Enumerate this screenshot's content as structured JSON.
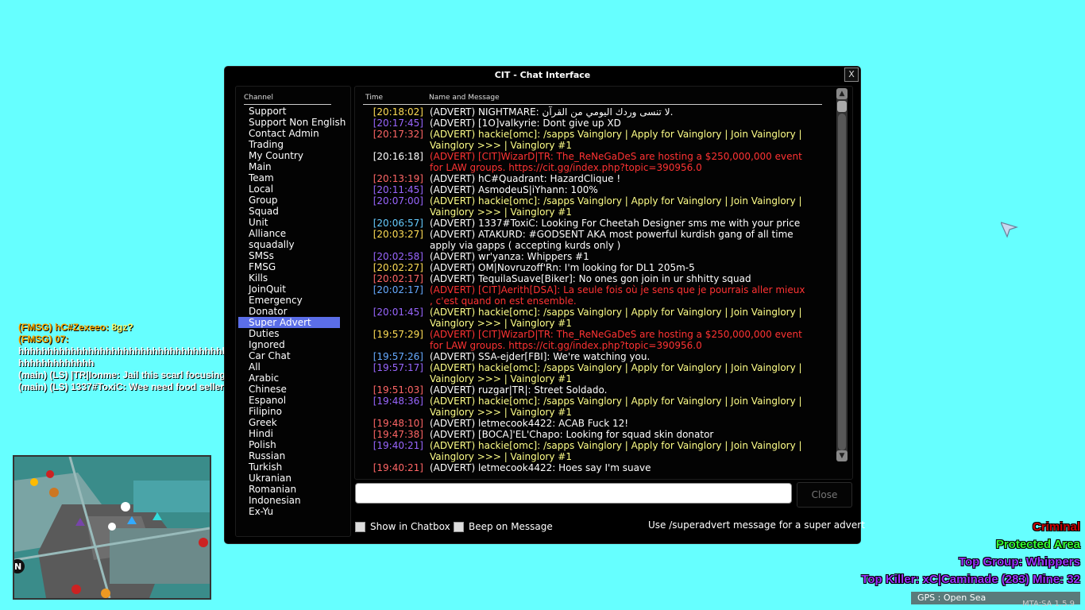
{
  "window": {
    "title": "CIT - Chat Interface",
    "close_x": "X",
    "channel_header": "Channel",
    "time_header": "Time",
    "name_header": "Name and Message",
    "close_button": "Close",
    "input_value": "",
    "show_in_chatbox": "Show in Chatbox",
    "beep_on_message": "Beep on Message",
    "hint": "Use /superadvert message for a super advert"
  },
  "channels": [
    "Support",
    "Support Non English",
    "Contact Admin",
    "Trading",
    "My Country",
    "Main",
    "Team",
    "Local",
    "Group",
    "Squad",
    "Unit",
    "Alliance",
    "squadally",
    "SMSs",
    "FMSG",
    "Kills",
    "JoinQuit",
    "Emergency",
    "Donator",
    "Super Advert",
    "Duties",
    "Ignored",
    "Car Chat",
    "All",
    "Arabic",
    "Chinese",
    "Espanol",
    "Filipino",
    "Greek",
    "Hindi",
    "Polish",
    "Russian",
    "Turkish",
    "Ukranian",
    "Romanian",
    "Indonesian",
    "Ex-Yu"
  ],
  "selected_channel": "Super Advert",
  "messages": [
    {
      "time": "[20:18:02]",
      "tcolor": "#ffdd55",
      "text": "(ADVERT) NIGHTMARE: لا تنسى وردك اليومي من القرآن.",
      "mcolor": "#ffffff"
    },
    {
      "time": "[20:17:45]",
      "tcolor": "#9966ff",
      "text": "(ADVERT) [1O]valkyrie: Dont give up XD",
      "mcolor": "#ffffff"
    },
    {
      "time": "[20:17:32]",
      "tcolor": "#ff6666",
      "text": "(ADVERT) hackie[omc]: /sapps Vainglory | Apply for Vainglory | Join Vainglory | Vainglory >>> | Vainglory #1",
      "mcolor": "#ffff88"
    },
    {
      "time": "[20:16:18]",
      "tcolor": "#ffffff",
      "text": "(ADVERT) [CIT]WizarD|TR: The_ReNeGaDeS are hosting a $250,000,000 event for LAW groups. https://cit.gg/index.php?topic=390956.0",
      "mcolor": "#ff3333"
    },
    {
      "time": "[20:13:19]",
      "tcolor": "#ff6666",
      "text": "(ADVERT) hC#Quadrant: HazardClique !",
      "mcolor": "#ffffff"
    },
    {
      "time": "[20:11:45]",
      "tcolor": "#9966ff",
      "text": "(ADVERT) AsmodeuS|iYhann: 100%",
      "mcolor": "#ffffff"
    },
    {
      "time": "[20:07:00]",
      "tcolor": "#9966ff",
      "text": "(ADVERT) hackie[omc]: /sapps Vainglory | Apply for Vainglory | Join Vainglory | Vainglory >>> | Vainglory #1",
      "mcolor": "#ffff88"
    },
    {
      "time": "[20:06:57]",
      "tcolor": "#66ccff",
      "text": "(ADVERT) 1337#ToxiC: Looking For Cheetah Designer sms me with your price",
      "mcolor": "#ffffff"
    },
    {
      "time": "[20:03:27]",
      "tcolor": "#ffdd55",
      "text": "(ADVERT) ATAKURD: #GODSENT AKA most powerful kurdish gang of all time apply via gapps ( accepting kurds only )",
      "mcolor": "#ffffff"
    },
    {
      "time": "[20:02:58]",
      "tcolor": "#9966ff",
      "text": "(ADVERT) wr'yanza: Whippers #1",
      "mcolor": "#ffffff"
    },
    {
      "time": "[20:02:27]",
      "tcolor": "#ffdd55",
      "text": "(ADVERT) OM|Novruzoff'Rn: I'm looking for DL1 205m-5",
      "mcolor": "#ffffff"
    },
    {
      "time": "[20:02:17]",
      "tcolor": "#ff6666",
      "text": "(ADVERT) TequilaSuave[Biker]: No ones gon join in ur shhitty squad",
      "mcolor": "#ffffff"
    },
    {
      "time": "[20:02:17]",
      "tcolor": "#66aaff",
      "text": "(ADVERT) [CIT]Aerith[DSA]: La seule fois où je sens que je pourrais aller mieux , c'est quand on est ensemble.",
      "mcolor": "#ff3333"
    },
    {
      "time": "[20:01:45]",
      "tcolor": "#9966ff",
      "text": "(ADVERT) hackie[omc]: /sapps Vainglory | Apply for Vainglory | Join Vainglory | Vainglory >>> | Vainglory #1",
      "mcolor": "#ffff88"
    },
    {
      "time": "[19:57:29]",
      "tcolor": "#ffdd55",
      "text": "(ADVERT) [CIT]WizarD|TR: The_ReNeGaDeS are hosting a $250,000,000 event for LAW groups. https://cit.gg/index.php?topic=390956.0",
      "mcolor": "#ff3333"
    },
    {
      "time": "[19:57:26]",
      "tcolor": "#66aaff",
      "text": "(ADVERT) SSA-ejder[FBI]: We're watching you.",
      "mcolor": "#ffffff"
    },
    {
      "time": "[19:57:17]",
      "tcolor": "#9966ff",
      "text": "(ADVERT) hackie[omc]: /sapps Vainglory | Apply for Vainglory | Join Vainglory | Vainglory >>> | Vainglory #1",
      "mcolor": "#ffff88"
    },
    {
      "time": "[19:51:03]",
      "tcolor": "#ff6666",
      "text": "(ADVERT) ruzgar|TR|: Street Soldado.",
      "mcolor": "#ffffff"
    },
    {
      "time": "[19:48:36]",
      "tcolor": "#9966ff",
      "text": "(ADVERT) hackie[omc]: /sapps Vainglory | Apply for Vainglory | Join Vainglory | Vainglory >>> | Vainglory #1",
      "mcolor": "#ffff88"
    },
    {
      "time": "[19:48:10]",
      "tcolor": "#ff6666",
      "text": "(ADVERT) letmecook4422: ACAB Fuck 12!",
      "mcolor": "#ffffff"
    },
    {
      "time": "[19:47:38]",
      "tcolor": "#ff6666",
      "text": "(ADVERT) [BOCA]'EL'Chapo: Looking for squad skin donator",
      "mcolor": "#ffffff"
    },
    {
      "time": "[19:40:21]",
      "tcolor": "#9966ff",
      "text": "(ADVERT) hackie[omc]: /sapps Vainglory | Apply for Vainglory | Join Vainglory | Vainglory >>> | Vainglory #1",
      "mcolor": "#ffff88"
    },
    {
      "time": "[19:40:21]",
      "tcolor": "#ff6666",
      "text": "(ADVERT) letmecook4422: Hoes say I'm suave",
      "mcolor": "#ffffff"
    }
  ],
  "background_chat": [
    {
      "prefix": "(FMSG) hC#Zexeeo:",
      "text": " 8gz?",
      "pcolor": "#ffaa00",
      "tcolor": "#ffff66"
    },
    {
      "prefix": "(FMSG) 07:",
      "text": "",
      "pcolor": "#ffaa00",
      "tcolor": "#ffff66"
    },
    {
      "prefix": "",
      "text": "hhhhhhhhhhhhhhhhhhhhhhhhhhhhhhhhhhhhhhhhhhhhh",
      "pcolor": "#ffffff",
      "tcolor": "#ffffff"
    },
    {
      "prefix": "",
      "text": "hhhhhhhhhhhhh",
      "pcolor": "#ffffff",
      "tcolor": "#ffffff"
    },
    {
      "prefix": "(main) (LS) |TR|Ionme:",
      "text": " Jail this scarl focusing",
      "pcolor": "#ffffff",
      "tcolor": "#ffffff"
    },
    {
      "prefix": "(main) (LS) 1337#ToxiC:",
      "text": " Wee need food seller",
      "pcolor": "#ffffff",
      "tcolor": "#ffffff"
    }
  ],
  "hud": {
    "criminal": "Criminal",
    "criminal_color": "#cc0000",
    "zone": "Protected Area",
    "zone_color": "#33ff33",
    "group": "Top Group: Whippers",
    "group_color": "#9933ff",
    "killer": "Top Killer: xC|Caminade (283) Mine: 32",
    "killer_color": "#9933ff",
    "gps": "GPS : Open Sea",
    "version": "MTA:SA 1.5.9"
  }
}
